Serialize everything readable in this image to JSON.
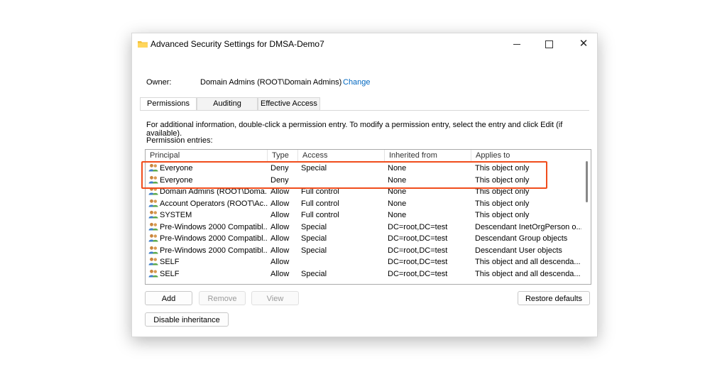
{
  "window": {
    "title": "Advanced Security Settings for DMSA-Demo7",
    "minimize_label": "",
    "close_glyph": "✕"
  },
  "owner": {
    "label": "Owner:",
    "value": "Domain Admins (ROOT\\Domain Admins)",
    "change_link": "Change"
  },
  "tabs": [
    {
      "label": "Permissions",
      "active": true
    },
    {
      "label": "Auditing",
      "active": false
    },
    {
      "label": "Effective Access",
      "active": false
    }
  ],
  "permissions": {
    "info_text": "For additional information, double-click a permission entry. To modify a permission entry, select the entry and click Edit (if available).",
    "entries_label": "Permission entries:",
    "columns": [
      "Principal",
      "Type",
      "Access",
      "Inherited from",
      "Applies to"
    ],
    "rows": [
      {
        "principal": "Everyone",
        "type": "Deny",
        "access": "Special",
        "inherited": "None",
        "applies": "This object only"
      },
      {
        "principal": "Everyone",
        "type": "Deny",
        "access": "",
        "inherited": "None",
        "applies": "This object only"
      },
      {
        "principal": "Domain Admins (ROOT\\Doma...",
        "type": "Allow",
        "access": "Full control",
        "inherited": "None",
        "applies": "This object only"
      },
      {
        "principal": "Account Operators (ROOT\\Ac...",
        "type": "Allow",
        "access": "Full control",
        "inherited": "None",
        "applies": "This object only"
      },
      {
        "principal": "SYSTEM",
        "type": "Allow",
        "access": "Full control",
        "inherited": "None",
        "applies": "This object only"
      },
      {
        "principal": "Pre-Windows 2000 Compatibl...",
        "type": "Allow",
        "access": "Special",
        "inherited": "DC=root,DC=test",
        "applies": "Descendant InetOrgPerson o..."
      },
      {
        "principal": "Pre-Windows 2000 Compatibl...",
        "type": "Allow",
        "access": "Special",
        "inherited": "DC=root,DC=test",
        "applies": "Descendant Group objects"
      },
      {
        "principal": "Pre-Windows 2000 Compatibl...",
        "type": "Allow",
        "access": "Special",
        "inherited": "DC=root,DC=test",
        "applies": "Descendant User objects"
      },
      {
        "principal": "SELF",
        "type": "Allow",
        "access": "",
        "inherited": "DC=root,DC=test",
        "applies": "This object and all descenda..."
      },
      {
        "principal": "SELF",
        "type": "Allow",
        "access": "Special",
        "inherited": "DC=root,DC=test",
        "applies": "This object and all descenda..."
      }
    ]
  },
  "buttons": {
    "add": "Add",
    "remove": "Remove",
    "view": "View",
    "restore_defaults": "Restore defaults",
    "disable_inheritance": "Disable inheritance"
  },
  "colors": {
    "highlight": "#f04d1c",
    "link": "#0067c0"
  },
  "icons": {
    "title": "folder-icon",
    "principal": "users-icon"
  }
}
